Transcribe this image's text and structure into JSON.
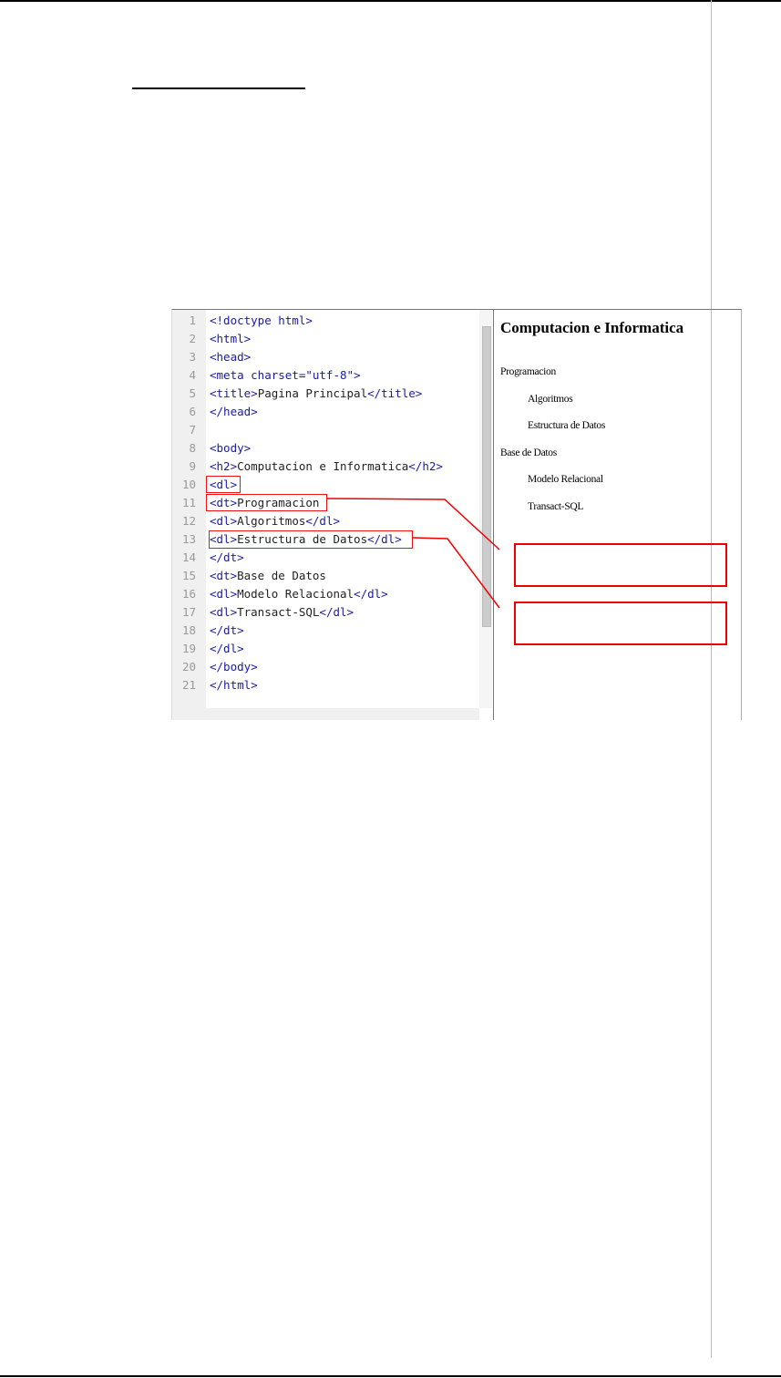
{
  "editor": {
    "line_numbers": [
      "1",
      "2",
      "3",
      "4",
      "5",
      "6",
      "7",
      "8",
      "9",
      "10",
      "11",
      "12",
      "13",
      "14",
      "15",
      "16",
      "17",
      "18",
      "19",
      "20",
      "21"
    ],
    "lines": [
      [
        {
          "tag": "<!doctype html>"
        }
      ],
      [
        {
          "tag": "<html>"
        }
      ],
      [
        {
          "tag": "<head>"
        }
      ],
      [
        {
          "tag": "<meta charset=\"utf-8\">"
        }
      ],
      [
        {
          "tag": "<title>"
        },
        {
          "text": "Pagina Principal"
        },
        {
          "tag": "</title>"
        }
      ],
      [
        {
          "tag": "</head>"
        }
      ],
      [],
      [
        {
          "tag": "<body>"
        }
      ],
      [
        {
          "tag": "<h2>"
        },
        {
          "text": "Computacion e Informatica"
        },
        {
          "tag": "</h2>"
        }
      ],
      [
        {
          "tag": "<dl>"
        }
      ],
      [
        {
          "tag": "<dt>"
        },
        {
          "text": "Programacion"
        }
      ],
      [
        {
          "tag": "<dl>"
        },
        {
          "text": "Algoritmos"
        },
        {
          "tag": "</dl>"
        }
      ],
      [
        {
          "tag": "<dl>"
        },
        {
          "text": "Estructura de Datos"
        },
        {
          "tag": "</dl>"
        }
      ],
      [
        {
          "tag": "</dt>"
        }
      ],
      [
        {
          "tag": "<dt>"
        },
        {
          "text": "Base de Datos"
        }
      ],
      [
        {
          "tag": "<dl>"
        },
        {
          "text": "Modelo Relacional"
        },
        {
          "tag": "</dl>"
        }
      ],
      [
        {
          "tag": "<dl>"
        },
        {
          "text": "Transact-SQL"
        },
        {
          "tag": "</dl>"
        }
      ],
      [
        {
          "tag": "</dt>"
        }
      ],
      [
        {
          "tag": "</dl>"
        }
      ],
      [
        {
          "tag": "</body>"
        }
      ],
      [
        {
          "tag": "</html>"
        }
      ]
    ]
  },
  "preview": {
    "heading": "Computacion e Informatica",
    "items": [
      {
        "text": "Programacion",
        "level": 0
      },
      {
        "text": "Algoritmos",
        "level": 1
      },
      {
        "text": "Estructura de Datos",
        "level": 1
      },
      {
        "text": "Base de Datos",
        "level": 0
      },
      {
        "text": "Modelo Relacional",
        "level": 1
      },
      {
        "text": "Transact-SQL",
        "level": 1
      }
    ]
  },
  "colors": {
    "tag": "#1a1aa6",
    "highlight": "#e00000"
  }
}
